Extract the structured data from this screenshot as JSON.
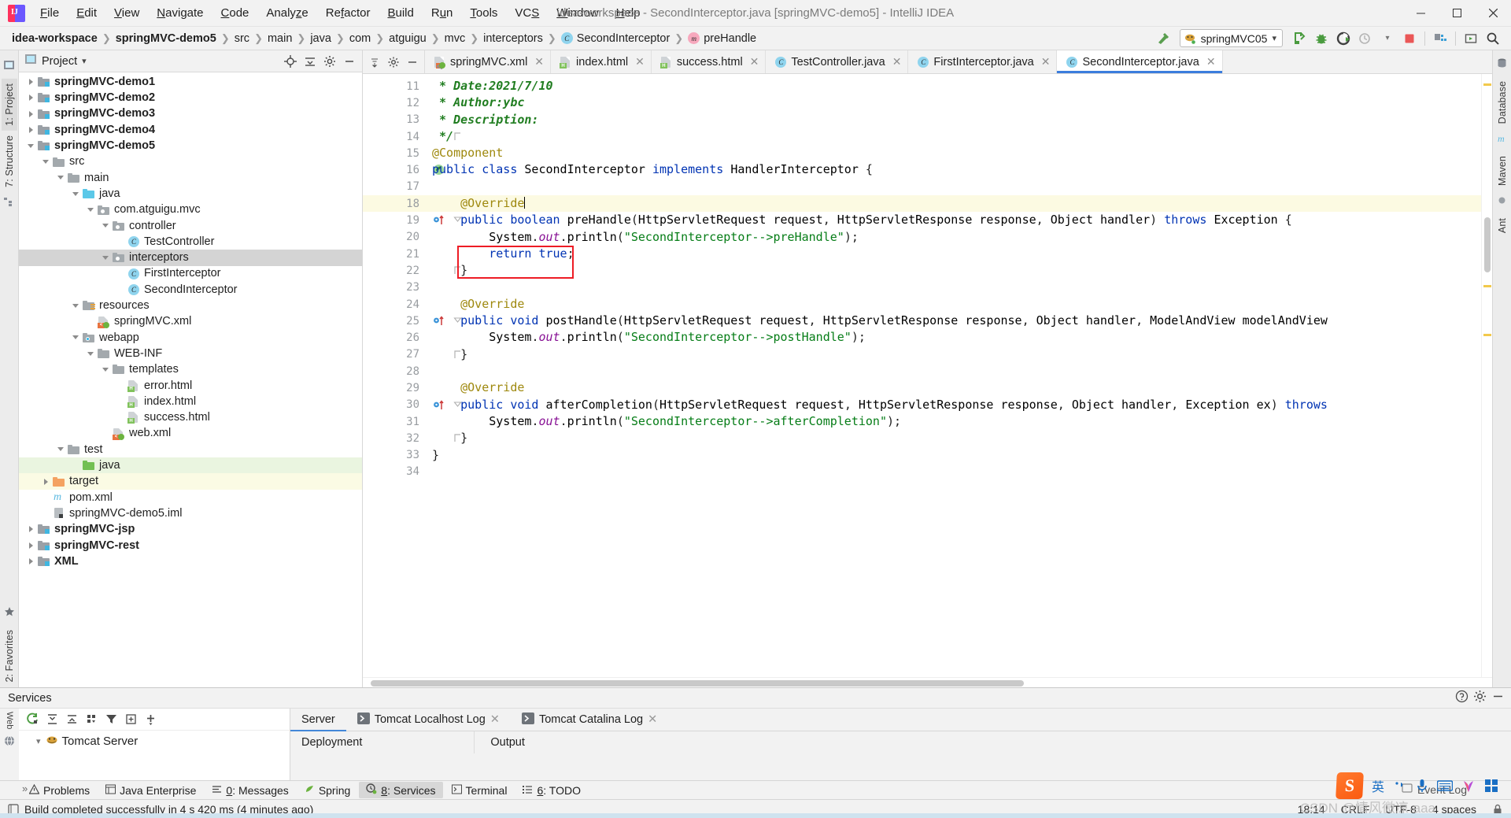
{
  "window": {
    "title": "idea-workspace - SecondInterceptor.java [springMVC-demo5] - IntelliJ IDEA",
    "minimize": "–",
    "maximize": "❐",
    "close": "✕"
  },
  "menubar": [
    {
      "label": "File"
    },
    {
      "label": "Edit"
    },
    {
      "label": "View"
    },
    {
      "label": "Navigate"
    },
    {
      "label": "Code"
    },
    {
      "label": "Analyze"
    },
    {
      "label": "Refactor"
    },
    {
      "label": "Build"
    },
    {
      "label": "Run"
    },
    {
      "label": "Tools"
    },
    {
      "label": "VCS"
    },
    {
      "label": "Window"
    },
    {
      "label": "Help"
    }
  ],
  "breadcrumb": [
    {
      "label": "idea-workspace",
      "bold": true,
      "icon": ""
    },
    {
      "label": "springMVC-demo5",
      "bold": true,
      "icon": ""
    },
    {
      "label": "src",
      "bold": false,
      "icon": ""
    },
    {
      "label": "main",
      "bold": false,
      "icon": ""
    },
    {
      "label": "java",
      "bold": false,
      "icon": ""
    },
    {
      "label": "com",
      "bold": false,
      "icon": ""
    },
    {
      "label": "atguigu",
      "bold": false,
      "icon": ""
    },
    {
      "label": "mvc",
      "bold": false,
      "icon": ""
    },
    {
      "label": "interceptors",
      "bold": false,
      "icon": ""
    },
    {
      "label": "SecondInterceptor",
      "bold": false,
      "icon": "class-icon"
    },
    {
      "label": "preHandle",
      "bold": false,
      "icon": "method-icon"
    }
  ],
  "toolbar": {
    "run_config": "springMVC05",
    "dropdown_arrow": "▾",
    "icons": [
      "hammer-build-icon",
      "run-icon",
      "debug-icon",
      "run-coverage-icon",
      "profile-icon",
      "stop-icon",
      "project-structure-icon",
      "window-icon",
      "search-everywhere-icon"
    ]
  },
  "project_panel": {
    "title": "Project",
    "dropdown_arrow": "▾",
    "header_icons": [
      "locate-icon",
      "collapse-all-icon",
      "settings-gear-icon",
      "hide-icon"
    ],
    "tree": [
      {
        "label": "springMVC-demo1",
        "depth": 1,
        "arrow": "right",
        "icon": "module-icon",
        "bold": true,
        "state": ""
      },
      {
        "label": "springMVC-demo2",
        "depth": 1,
        "arrow": "right",
        "icon": "module-icon",
        "bold": true,
        "state": ""
      },
      {
        "label": "springMVC-demo3",
        "depth": 1,
        "arrow": "right",
        "icon": "module-icon",
        "bold": true,
        "state": ""
      },
      {
        "label": "springMVC-demo4",
        "depth": 1,
        "arrow": "right",
        "icon": "module-icon",
        "bold": true,
        "state": ""
      },
      {
        "label": "springMVC-demo5",
        "depth": 1,
        "arrow": "down",
        "icon": "module-icon",
        "bold": true,
        "state": ""
      },
      {
        "label": "src",
        "depth": 2,
        "arrow": "down",
        "icon": "folder-icon",
        "bold": false,
        "state": ""
      },
      {
        "label": "main",
        "depth": 3,
        "arrow": "down",
        "icon": "folder-icon",
        "bold": false,
        "state": ""
      },
      {
        "label": "java",
        "depth": 4,
        "arrow": "down",
        "icon": "folder-source-icon",
        "bold": false,
        "state": ""
      },
      {
        "label": "com.atguigu.mvc",
        "depth": 5,
        "arrow": "down",
        "icon": "package-icon",
        "bold": false,
        "state": ""
      },
      {
        "label": "controller",
        "depth": 6,
        "arrow": "down",
        "icon": "package-icon",
        "bold": false,
        "state": ""
      },
      {
        "label": "TestController",
        "depth": 7,
        "arrow": "none",
        "icon": "class-icon",
        "bold": false,
        "state": ""
      },
      {
        "label": "interceptors",
        "depth": 6,
        "arrow": "down",
        "icon": "package-icon",
        "bold": false,
        "state": "selected"
      },
      {
        "label": "FirstInterceptor",
        "depth": 7,
        "arrow": "none",
        "icon": "class-icon",
        "bold": false,
        "state": ""
      },
      {
        "label": "SecondInterceptor",
        "depth": 7,
        "arrow": "none",
        "icon": "class-icon",
        "bold": false,
        "state": ""
      },
      {
        "label": "resources",
        "depth": 4,
        "arrow": "down",
        "icon": "folder-resources-icon",
        "bold": false,
        "state": ""
      },
      {
        "label": "springMVC.xml",
        "depth": 5,
        "arrow": "none",
        "icon": "spring-xml-icon",
        "bold": false,
        "state": ""
      },
      {
        "label": "webapp",
        "depth": 4,
        "arrow": "down",
        "icon": "folder-web-icon",
        "bold": false,
        "state": ""
      },
      {
        "label": "WEB-INF",
        "depth": 5,
        "arrow": "down",
        "icon": "folder-icon",
        "bold": false,
        "state": ""
      },
      {
        "label": "templates",
        "depth": 6,
        "arrow": "down",
        "icon": "folder-icon",
        "bold": false,
        "state": ""
      },
      {
        "label": "error.html",
        "depth": 7,
        "arrow": "none",
        "icon": "html-file-icon",
        "bold": false,
        "state": ""
      },
      {
        "label": "index.html",
        "depth": 7,
        "arrow": "none",
        "icon": "html-file-icon",
        "bold": false,
        "state": ""
      },
      {
        "label": "success.html",
        "depth": 7,
        "arrow": "none",
        "icon": "html-file-icon",
        "bold": false,
        "state": ""
      },
      {
        "label": "web.xml",
        "depth": 6,
        "arrow": "none",
        "icon": "xml-file-icon",
        "bold": false,
        "state": ""
      },
      {
        "label": "test",
        "depth": 3,
        "arrow": "down",
        "icon": "folder-icon",
        "bold": false,
        "state": ""
      },
      {
        "label": "java",
        "depth": 4,
        "arrow": "none",
        "icon": "folder-test-source-icon",
        "bold": false,
        "state": "green"
      },
      {
        "label": "target",
        "depth": 2,
        "arrow": "right",
        "icon": "folder-excluded-icon",
        "bold": false,
        "state": "yellow"
      },
      {
        "label": "pom.xml",
        "depth": 2,
        "arrow": "none",
        "icon": "maven-icon",
        "bold": false,
        "state": ""
      },
      {
        "label": "springMVC-demo5.iml",
        "depth": 2,
        "arrow": "none",
        "icon": "iml-file-icon",
        "bold": false,
        "state": ""
      },
      {
        "label": "springMVC-jsp",
        "depth": 1,
        "arrow": "right",
        "icon": "module-icon",
        "bold": true,
        "state": ""
      },
      {
        "label": "springMVC-rest",
        "depth": 1,
        "arrow": "right",
        "icon": "module-icon",
        "bold": true,
        "state": ""
      },
      {
        "label": "XML",
        "depth": 1,
        "arrow": "right",
        "icon": "module-icon",
        "bold": true,
        "state": ""
      }
    ]
  },
  "left_rail": [
    {
      "label": "1: Project",
      "active": true
    },
    {
      "label": "7: Structure",
      "active": false
    },
    {
      "label": "2: Favorites",
      "active": false
    }
  ],
  "right_rail": [
    {
      "label": "Database",
      "active": false
    },
    {
      "label": "Maven",
      "active": false
    },
    {
      "label": "Ant",
      "active": false
    }
  ],
  "bottom_left_rail": [
    {
      "label": "Web",
      "active": false
    }
  ],
  "editor": {
    "tabs": [
      {
        "label": "springMVC.xml",
        "icon": "xml-file-icon",
        "active": false,
        "close": "✕"
      },
      {
        "label": "index.html",
        "icon": "html-file-icon",
        "active": false,
        "close": "✕"
      },
      {
        "label": "success.html",
        "icon": "html-file-icon",
        "active": false,
        "close": "✕"
      },
      {
        "label": "TestController.java",
        "icon": "class-icon",
        "active": false,
        "close": "✕"
      },
      {
        "label": "FirstInterceptor.java",
        "icon": "class-icon",
        "active": false,
        "close": "✕"
      },
      {
        "label": "SecondInterceptor.java",
        "icon": "class-icon",
        "active": true,
        "close": "✕"
      }
    ],
    "line_numbers": [
      "11",
      "12",
      "13",
      "14",
      "15",
      "16",
      "17",
      "18",
      "19",
      "20",
      "21",
      "22",
      "23",
      "24",
      "25",
      "26",
      "27",
      "28",
      "29",
      "30",
      "31",
      "32",
      "33",
      "34"
    ],
    "code_lines": [
      " * Date:2021/7/10",
      " * Author:ybc",
      " * Description:",
      " */",
      "@Component",
      "public class SecondInterceptor implements HandlerInterceptor {",
      "",
      "    @Override",
      "    public boolean preHandle(HttpServletRequest request, HttpServletResponse response, Object handler) throws Exception {",
      "        System.out.println(\"SecondInterceptor-->preHandle\");",
      "        return true;",
      "    }",
      "",
      "    @Override",
      "    public void postHandle(HttpServletRequest request, HttpServletResponse response, Object handler, ModelAndView modelAndView",
      "        System.out.println(\"SecondInterceptor-->postHandle\");",
      "    }",
      "",
      "    @Override",
      "    public void afterCompletion(HttpServletRequest request, HttpServletResponse response, Object handler, Exception ex) throws",
      "        System.out.println(\"SecondInterceptor-->afterCompletion\");",
      "    }",
      "}",
      ""
    ],
    "highlighted_line": "18",
    "annotation": "red-box-around-return-true"
  },
  "services": {
    "panel_title": "Services",
    "toolbar_icons": [
      "rerun-icon",
      "expand-all-icon",
      "collapse-all-icon",
      "group-icon",
      "filter-icon",
      "add-frame-icon",
      "add-icon"
    ],
    "tree_root": "Tomcat Server",
    "tree_root_icon": "tomcat-icon",
    "tree_arrow": "▾",
    "tabs": [
      {
        "label": "Server",
        "icon": "",
        "active": true,
        "close": ""
      },
      {
        "label": "Tomcat Localhost Log",
        "icon": "console-icon",
        "active": false,
        "close": "✕"
      },
      {
        "label": "Tomcat Catalina Log",
        "icon": "console-icon",
        "active": false,
        "close": "✕"
      }
    ],
    "sub_items": [
      "Deployment",
      "Output"
    ],
    "header_icons": [
      "help-icon",
      "settings-gear-icon",
      "hide-icon"
    ]
  },
  "toolwindow_bar": [
    {
      "label": "Problems",
      "icon": "warning-icon",
      "active": false
    },
    {
      "label": "Java Enterprise",
      "icon": "java-ee-icon",
      "active": false
    },
    {
      "label": "0: Messages",
      "icon": "messages-icon",
      "active": false
    },
    {
      "label": "Spring",
      "icon": "spring-leaf-icon",
      "active": false
    },
    {
      "label": "8: Services",
      "icon": "services-icon",
      "active": true
    },
    {
      "label": "Terminal",
      "icon": "terminal-icon",
      "active": false
    },
    {
      "label": "6: TODO",
      "icon": "todo-icon",
      "active": false
    }
  ],
  "statusbar": {
    "message": "Build completed successfully in 4 s 420 ms (4 minutes ago)",
    "message_icon": "build-icon",
    "time": "18:14",
    "line_separator": "CRLF",
    "encoding": "UTF-8",
    "indent": "4 spaces",
    "lock_icon": "lock-icon",
    "event_log": "Event Log",
    "event_log_icon": "event-log-icon"
  },
  "tray": {
    "sogou_logo": "S",
    "mode": "英",
    "items": [
      "comma-icon",
      "microphone-icon",
      "keyboard-icon",
      "flower-icon",
      "apps-icon"
    ]
  },
  "watermark": "CSDN @情风微凉·aaa"
}
